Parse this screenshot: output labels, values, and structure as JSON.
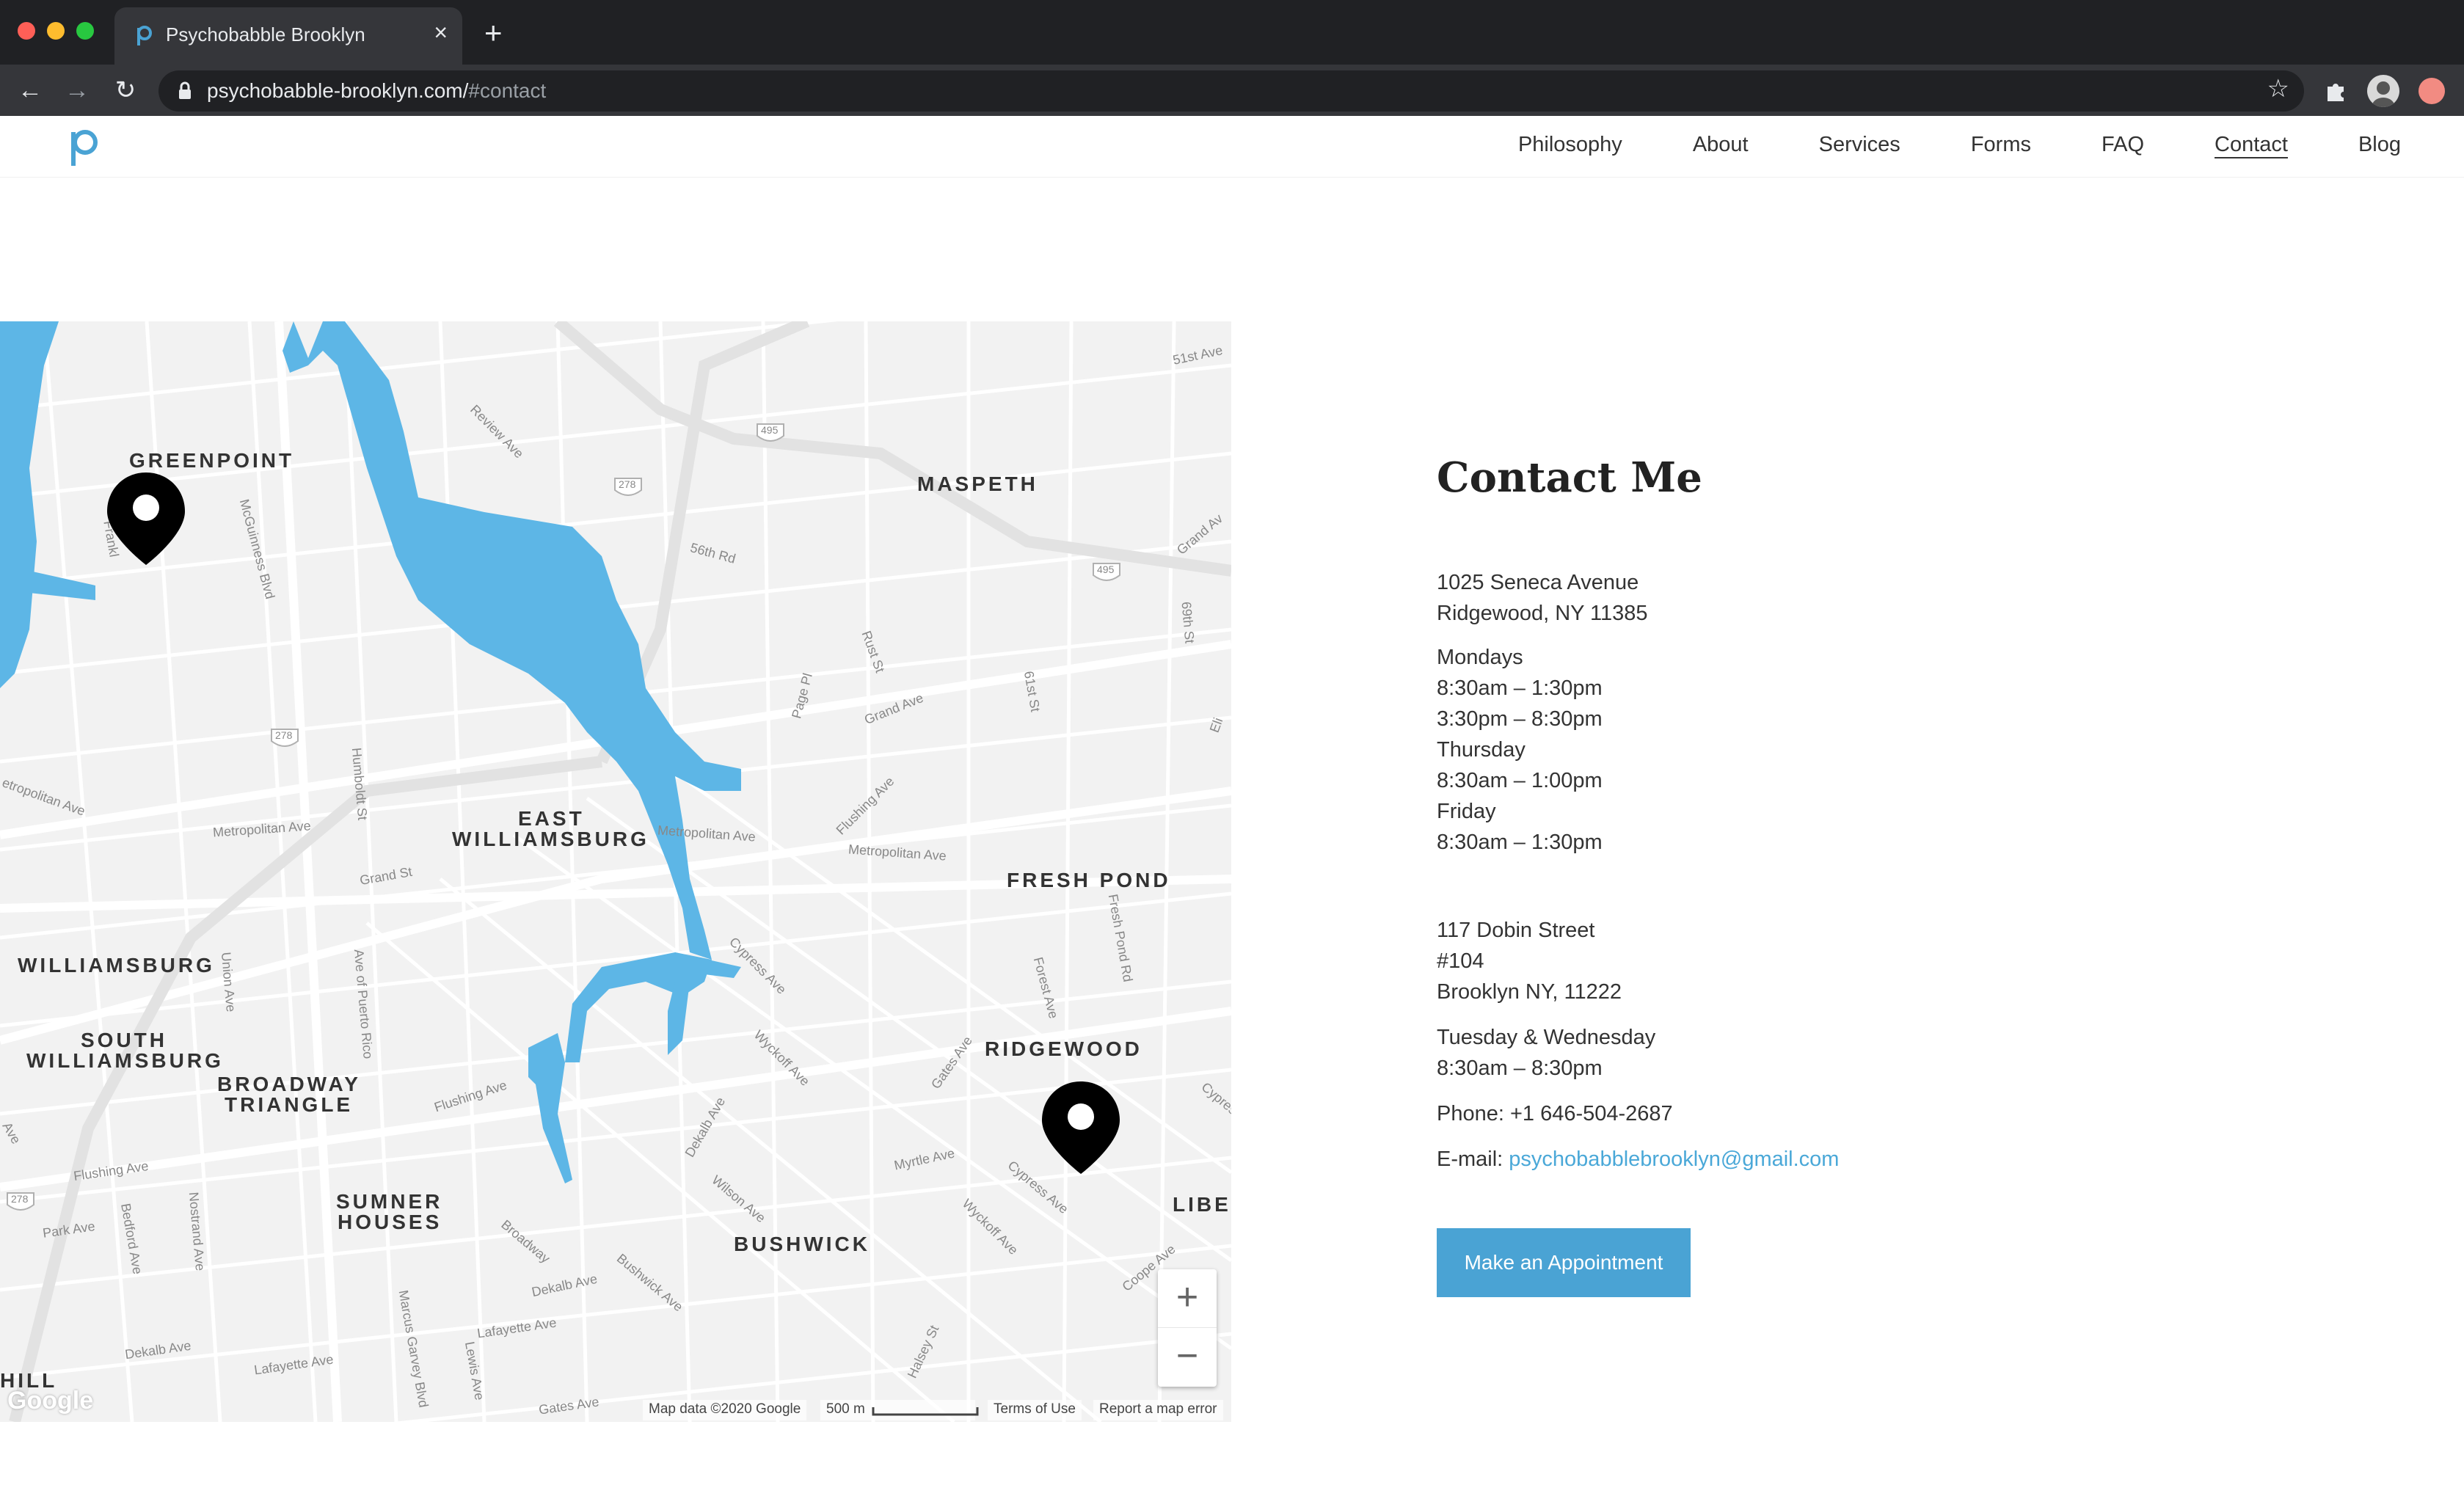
{
  "browser": {
    "tab_title": "Psychobabble Brooklyn",
    "tab_close": "×",
    "new_tab": "+",
    "url_host": "psychobabble-brooklyn.com/",
    "url_path": "#contact"
  },
  "site": {
    "nav": [
      "Philosophy",
      "About",
      "Services",
      "Forms",
      "FAQ",
      "Contact",
      "Blog"
    ],
    "active_nav": "Contact",
    "brand_color": "#4aa3d4"
  },
  "map": {
    "areas": {
      "greenpoint": "GREENPOINT",
      "maspeth": "MASPETH",
      "east_williamsburg_1": "EAST",
      "east_williamsburg_2": "WILLIAMSBURG",
      "fresh_pond": "FRESH POND",
      "williamsburg": "WILLIAMSBURG",
      "south_williamsburg_1": "SOUTH",
      "south_williamsburg_2": "WILLIAMSBURG",
      "broadway_triangle_1": "BROADWAY",
      "broadway_triangle_2": "TRIANGLE",
      "ridgewood": "RIDGEWOOD",
      "sumner_1": "SUMNER",
      "sumner_2": "HOUSES",
      "bushwick": "BUSHWICK",
      "libe": "LIBE",
      "hill": "HILL"
    },
    "streets": {
      "review_ave": "Review Ave",
      "mcguinness": "McGuinness Blvd",
      "st56": "56th Rd",
      "rust_st": "Rust St",
      "page_pl": "Page Pl",
      "grand_ave": "Grand Ave",
      "st61": "61st St",
      "st69": "69th St",
      "grand_ave_2": "Grand Av",
      "metropolitan_1": "Metropolitan Ave",
      "metropolitan_2": "Metropolitan Ave",
      "metropolitan_3": "Metropolitan Ave",
      "metropolitan_4": "etropolitan Ave",
      "humboldt": "Humboldt St",
      "grand_st": "Grand St",
      "flushing_1": "Flushing Ave",
      "union_ave": "Union Ave",
      "ave_pr": "Ave of Puerto Rico",
      "cypress_1": "Cypress Ave",
      "forest_ave": "Forest Ave",
      "fresh_pond_rd": "Fresh Pond Rd",
      "wyckoff_1": "Wyckoff Ave",
      "gates_ave": "Gates Ave",
      "flushing_2": "Flushing Ave",
      "dekalb_1": "Dekalb Ave",
      "myrtle": "Myrtle Ave",
      "cypress_2": "Cypress Ave",
      "wyckoff_2": "Wyckoff Ave",
      "flushing_3": "Flushing Ave",
      "park_ave": "Park Ave",
      "bedford": "Bedford Ave",
      "nostrand": "Nostrand Ave",
      "broadway": "Broadway",
      "wilson": "Wilson Ave",
      "bushwick_ave": "Bushwick Ave",
      "dekalb_2": "Dekalb Ave",
      "lafayette_1": "Lafayette Ave",
      "dekalb_3": "Dekalb Ave",
      "lafayette_2": "Lafayette Ave",
      "marcus": "Marcus Garvey Blvd",
      "lewis": "Lewis Ave",
      "gates_ave_2": "Gates Ave",
      "halsey": "Halsey St",
      "cooper": "Coope Ave",
      "cypress_3": "Cypress",
      "st51": "51st Ave",
      "franklin": "Frankl",
      "eli": "Eli",
      "ave": "Ave",
      "i278_1": "278",
      "i278_2": "278",
      "i278_3": "278",
      "i495_1": "495",
      "i495_2": "495"
    },
    "attribution": "Map data ©2020 Google",
    "scale": "500 m",
    "terms": "Terms of Use",
    "report": "Report a map error",
    "google": "Google",
    "zoom_in": "+",
    "zoom_out": "−"
  },
  "contact": {
    "title": "Contact Me",
    "location1": {
      "street": "1025 Seneca Avenue",
      "city": "Ridgewood, NY 11385",
      "hours": [
        "Mondays",
        "8:30am – 1:30pm",
        "3:30pm – 8:30pm",
        "Thursday",
        "8:30am – 1:00pm",
        "Friday",
        "8:30am – 1:30pm"
      ]
    },
    "location2": {
      "street": "117 Dobin Street",
      "suite": "#104",
      "city": "Brooklyn NY, 11222",
      "days": "Tuesday & Wednesday",
      "hours": "8:30am – 8:30pm"
    },
    "phone": "Phone: +1 646-504-2687",
    "email_label": "E-mail: ",
    "email": "psychobabblebrooklyn@gmail.com",
    "button": "Make an Appointment"
  }
}
